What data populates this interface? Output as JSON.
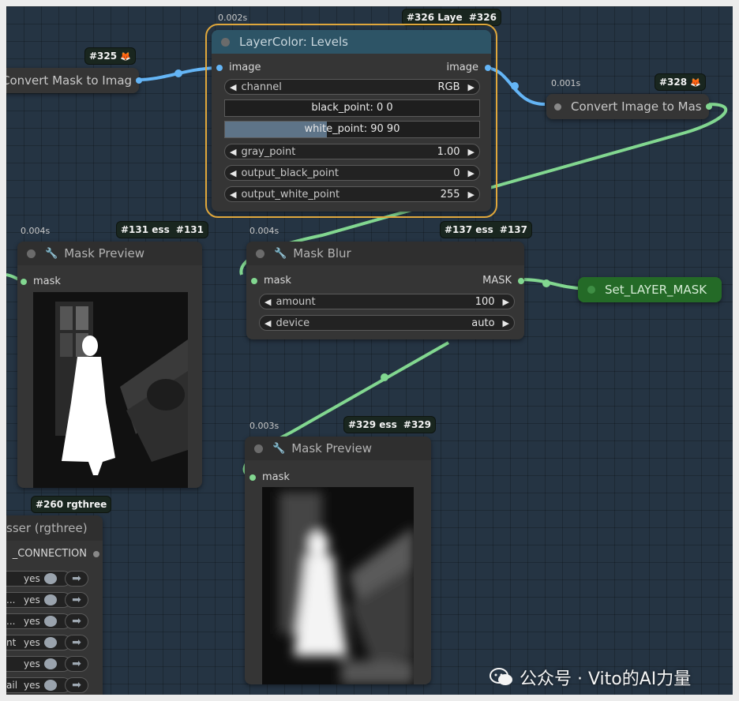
{
  "colors": {
    "mask_link": "#82d790",
    "image_link": "#64b5f6",
    "selection": "#e0a73b"
  },
  "nodes": {
    "convert_mask_to_image": {
      "badge": "#325",
      "title": "Convert Mask to Imag"
    },
    "layer_levels": {
      "timing": "0.002s",
      "badge": "#326 Laye",
      "badge2": "#326",
      "title": "LayerColor: Levels",
      "input_label": "image",
      "output_label": "image",
      "widgets": {
        "channel": {
          "label": "channel",
          "value": "RGB"
        },
        "black_point": {
          "text": "black_point: 0  0",
          "value": 0
        },
        "white_point": {
          "text": "white_point: 90  90",
          "fill_pct": 40
        },
        "gray_point": {
          "label": "gray_point",
          "value": "1.00"
        },
        "output_black_point": {
          "label": "output_black_point",
          "value": "0"
        },
        "output_white_point": {
          "label": "output_white_point",
          "value": "255"
        }
      }
    },
    "convert_image_to_mask": {
      "timing": "0.001s",
      "badge": "#328",
      "title": "Convert Image to Mas"
    },
    "mask_preview_131": {
      "timing": "0.004s",
      "badge": "#131 ess",
      "badge2": "#131",
      "title": "Mask Preview",
      "input_label": "mask"
    },
    "mask_blur_137": {
      "timing": "0.004s",
      "badge": "#137 ess",
      "badge2": "#137",
      "title": "Mask Blur",
      "input_label": "mask",
      "output_label": "MASK",
      "amount": {
        "label": "amount",
        "value": "100"
      },
      "device": {
        "label": "device",
        "value": "auto"
      }
    },
    "set_layer_mask": {
      "title": "Set_LAYER_MASK"
    },
    "mask_preview_329": {
      "timing": "0.003s",
      "badge": "#329 ess",
      "badge2": "#329",
      "title": "Mask Preview",
      "input_label": "mask"
    },
    "rgthree_260": {
      "badge": "#260 rgthree",
      "title": "sser (rgthree)",
      "output_label": "_CONNECTION",
      "rows": [
        {
          "key": "",
          "value": "yes"
        },
        {
          "key": "...",
          "value": "yes"
        },
        {
          "key": "...",
          "value": "yes"
        },
        {
          "key": "nt",
          "value": "yes"
        },
        {
          "key": "",
          "value": "yes"
        },
        {
          "key": "ail",
          "value": "yes"
        }
      ]
    }
  },
  "icons": {
    "dropdown_left": "◀",
    "dropdown_right": "▶",
    "wrench": "🔧",
    "fox": "🦊",
    "go_arrow": "➡"
  },
  "watermark": {
    "text": "公众号 · Vito的AI力量"
  }
}
